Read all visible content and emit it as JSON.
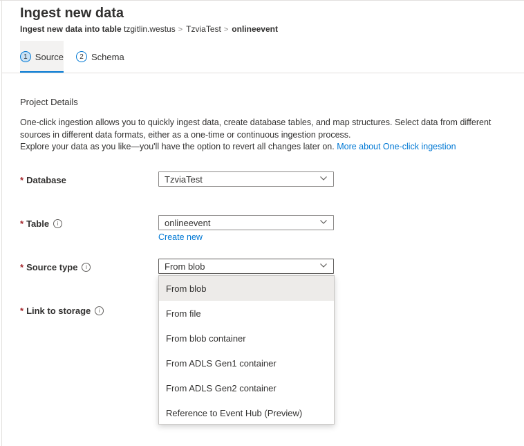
{
  "page": {
    "title": "Ingest new data",
    "breadcrumb": {
      "lead": "Ingest new data into table",
      "cluster": "tzgitlin.westus",
      "database": "TzviaTest",
      "table": "onlineevent"
    }
  },
  "tabs": [
    {
      "number": "1",
      "label": "Source",
      "active": true
    },
    {
      "number": "2",
      "label": "Schema",
      "active": false
    }
  ],
  "section": {
    "title": "Project Details",
    "description_line1": "One-click ingestion allows you to quickly ingest data, create database tables, and map structures. Select data from different sources in different data formats, either as a one-time or continuous ingestion process.",
    "description_line2": "Explore your data as you like—you'll have the option to revert all changes later on.",
    "link_text": "More about One-click ingestion"
  },
  "fields": {
    "required_marker": "*",
    "info_glyph": "i",
    "database": {
      "label": "Database",
      "value": "TzviaTest"
    },
    "table": {
      "label": "Table",
      "value": "onlineevent",
      "create_new": "Create new"
    },
    "source_type": {
      "label": "Source type",
      "value": "From blob"
    },
    "link_to_storage": {
      "label": "Link to storage"
    }
  },
  "source_type_options": [
    {
      "label": "From blob",
      "selected": true
    },
    {
      "label": "From file",
      "selected": false
    },
    {
      "label": "From blob container",
      "selected": false
    },
    {
      "label": "From ADLS Gen1 container",
      "selected": false
    },
    {
      "label": "From ADLS Gen2 container",
      "selected": false
    },
    {
      "label": "Reference to Event Hub (Preview)",
      "selected": false
    }
  ],
  "icons": {
    "breadcrumb_separator": "chevron-right-icon",
    "dropdown_caret": "chevron-down-icon",
    "info": "info-icon"
  },
  "colors": {
    "accent": "#0078d4",
    "required": "#a4262c",
    "selected_option_bg": "#edebe9",
    "active_tab_bg": "#f3f2f1"
  }
}
